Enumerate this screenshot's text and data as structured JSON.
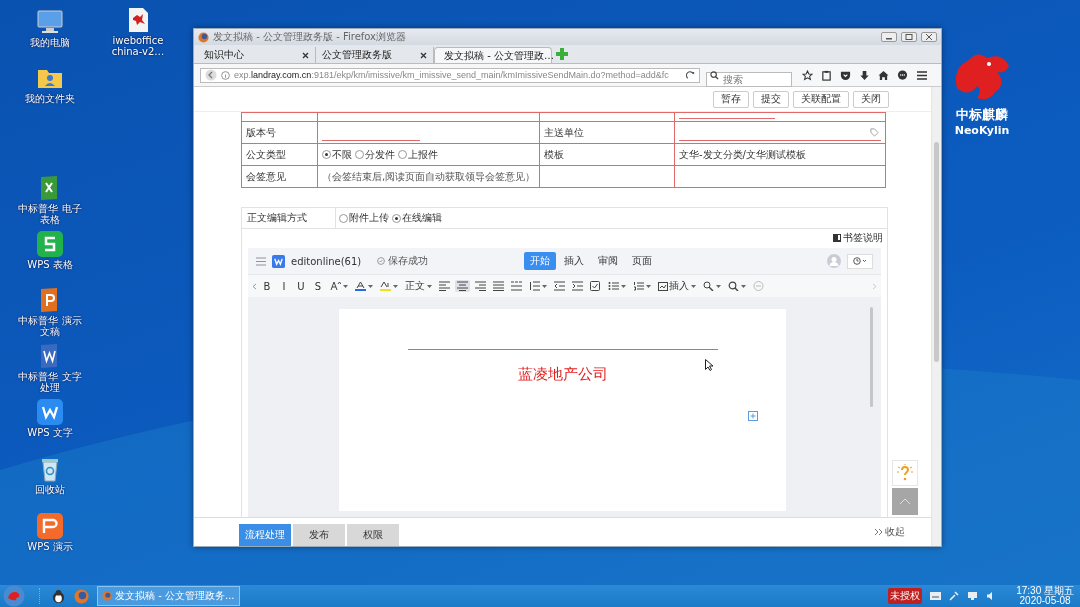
{
  "desktop": {
    "icons": [
      {
        "label": "我的电脑",
        "kind": "monitor"
      },
      {
        "label": "iweboffice china-v2…",
        "kind": "file"
      },
      {
        "label": "我的文件夹",
        "kind": "folder"
      },
      {
        "label": "中标普华 电子表格",
        "kind": "sheet"
      },
      {
        "label": "WPS 表格",
        "kind": "wps-s"
      },
      {
        "label": "中标普华 演示文稿",
        "kind": "slides"
      },
      {
        "label": "中标普华 文字处理",
        "kind": "doc"
      },
      {
        "label": "WPS 文字",
        "kind": "wps-w"
      },
      {
        "label": "回收站",
        "kind": "trash"
      },
      {
        "label": "WPS 演示",
        "kind": "wps-p"
      }
    ],
    "logo": {
      "name": "中标麒麟",
      "latin": "NeoKylin"
    }
  },
  "window": {
    "title": "发文拟稿 - 公文管理政务版 - Firefox浏览器",
    "tabs": [
      {
        "label": "知识中心",
        "selected": false
      },
      {
        "label": "公文管理政务版",
        "selected": false
      },
      {
        "label": "发文拟稿 - 公文管理政…",
        "selected": true
      }
    ],
    "url": "exp.**landray.com.cn**:9181/ekp/km/imissive/km_imissive_send_main/kmImissiveSendMain.do?method=add&fc",
    "search": {
      "placeholder": "搜索"
    }
  },
  "page": {
    "actions": [
      "暂存",
      "提交",
      "关联配置",
      "关闭"
    ],
    "form": [
      {
        "kind": "fields",
        "label": "版本号",
        "label_2": "主送单位"
      },
      {
        "kind": "type",
        "label": "公文类型",
        "options": [
          {
            "label": "不限",
            "selected": true
          },
          {
            "label": "分发件",
            "selected": false
          },
          {
            "label": "上报件",
            "selected": false
          }
        ],
        "label_2": "模板",
        "value_2": "文华-发文分类/文华测试模板"
      },
      {
        "kind": "note",
        "label": "会签意见",
        "value": "（会签结束后,阅读页面自动获取领导会签意见）"
      }
    ],
    "edit_mode": {
      "label": "正文编辑方式",
      "options": [
        {
          "label": "附件上传",
          "selected": false
        },
        {
          "label": "在线编辑",
          "selected": true
        }
      ]
    },
    "bookmark_help": "书签说明",
    "editor": {
      "doc_name": "editonline(61)",
      "save_status": "保存成功",
      "tabs": [
        {
          "label": "开始",
          "selected": true
        },
        {
          "label": "插入",
          "selected": false
        },
        {
          "label": "审阅",
          "selected": false
        },
        {
          "label": "页面",
          "selected": false
        }
      ],
      "toolbar": [
        {
          "kind": "text",
          "label": "B",
          "selected": false
        },
        {
          "kind": "text",
          "label": "I",
          "selected": false
        },
        {
          "kind": "text",
          "label": "U",
          "selected": false
        },
        {
          "kind": "text",
          "label": "S",
          "selected": false
        },
        {
          "kind": "font-size",
          "selected": false
        },
        {
          "kind": "font-color",
          "selected": false
        },
        {
          "kind": "highlight",
          "selected": false
        },
        {
          "kind": "style",
          "label": "正文",
          "selected": false
        },
        {
          "kind": "align-left",
          "selected": false
        },
        {
          "kind": "align-center",
          "selected": true
        },
        {
          "kind": "align-right",
          "selected": false
        },
        {
          "kind": "justify",
          "selected": false
        },
        {
          "kind": "distribute",
          "selected": false
        },
        {
          "kind": "line-spacing",
          "selected": false
        },
        {
          "kind": "indent-less",
          "selected": false
        },
        {
          "kind": "indent-more",
          "selected": false
        },
        {
          "kind": "checkbox",
          "selected": false
        },
        {
          "kind": "bullets",
          "selected": false
        },
        {
          "kind": "numbering",
          "selected": false
        },
        {
          "kind": "insert",
          "label": "插入",
          "selected": false
        },
        {
          "kind": "find",
          "selected": false
        },
        {
          "kind": "search",
          "selected": false
        },
        {
          "kind": "clear",
          "selected": false
        }
      ],
      "heading": "蓝凌地产公司"
    },
    "bottom_tabs": [
      {
        "label": "流程处理",
        "selected": true
      },
      {
        "label": "发布",
        "selected": false
      },
      {
        "label": "权限",
        "selected": false
      }
    ],
    "collapse": "收起"
  },
  "taskbar": {
    "task": "发文拟稿 - 公文管理政务...",
    "badge": "未授权",
    "time": "17:30 星期五",
    "date": "2020-05-08"
  }
}
